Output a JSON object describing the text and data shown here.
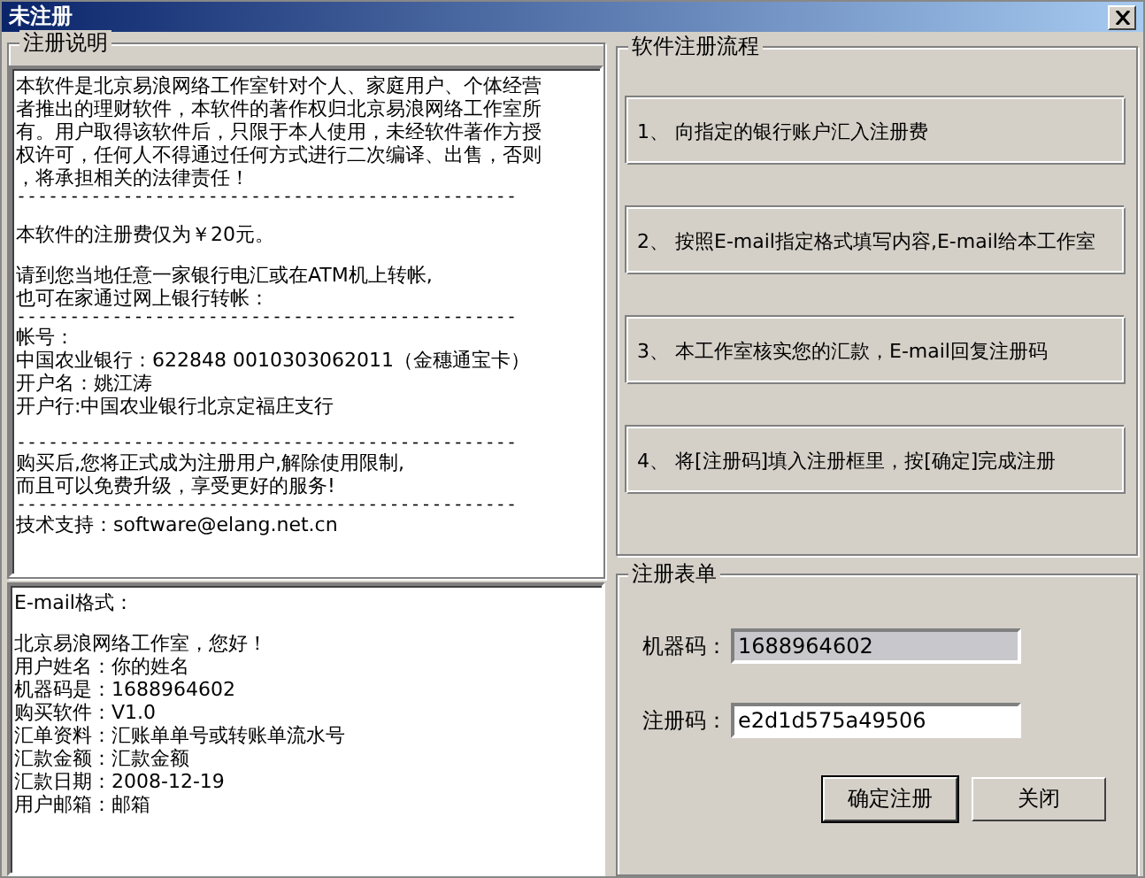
{
  "window": {
    "title": "未注册"
  },
  "notes": {
    "legend": "注册说明",
    "paragraphs": [
      {
        "lines": [
          {
            "kind": "text",
            "text": "本软件是北京易浪网络工作室针对个人、家庭用户、个体经营"
          },
          {
            "kind": "text",
            "text": "者推出的理财软件，本软件的著作权归北京易浪网络工作室所"
          },
          {
            "kind": "text",
            "text": "有。用户取得该软件后，只限于本人使用，未经软件著作方授"
          },
          {
            "kind": "text",
            "text": "权许可，任何人不得通过任何方式进行二次编译、出售，否则"
          },
          {
            "kind": "text",
            "text": "，将承担相关的法律责任！"
          },
          {
            "kind": "rule",
            "text": "-----------------------------------------------"
          }
        ]
      },
      {
        "lines": [
          {
            "kind": "text",
            "text": "本软件的注册费仅为￥20元。"
          }
        ]
      },
      {
        "lines": [
          {
            "kind": "text",
            "text": "请到您当地任意一家银行电汇或在ATM机上转帐,"
          },
          {
            "kind": "text",
            "text": "也可在家通过网上银行转帐："
          },
          {
            "kind": "rule",
            "text": "-----------------------------------------------"
          },
          {
            "kind": "text",
            "text": "帐号："
          },
          {
            "kind": "text",
            "text": "中国农业银行：622848   0010303062011（金穗通宝卡）"
          },
          {
            "kind": "text",
            "text": "开户名：姚江涛"
          },
          {
            "kind": "text",
            "text": "开户行:中国农业银行北京定福庄支行"
          }
        ]
      },
      {
        "lines": [
          {
            "kind": "rule",
            "text": "-----------------------------------------------"
          },
          {
            "kind": "text",
            "text": "购买后,您将正式成为注册用户,解除使用限制,"
          },
          {
            "kind": "text",
            "text": "而且可以免费升级，享受更好的服务!"
          },
          {
            "kind": "rule",
            "text": "-----------------------------------------------"
          },
          {
            "kind": "text",
            "text": "技术支持：software@elang.net.cn"
          }
        ]
      }
    ]
  },
  "email": {
    "paragraphs": [
      {
        "lines": [
          {
            "kind": "text",
            "text": "E-mail格式："
          }
        ]
      },
      {
        "lines": [
          {
            "kind": "text",
            "text": "北京易浪网络工作室，您好！"
          },
          {
            "kind": "text",
            "text": "用户姓名：你的姓名"
          },
          {
            "kind": "text",
            "text": "机器码是：1688964602"
          },
          {
            "kind": "text",
            "text": "购买软件：V1.0"
          },
          {
            "kind": "text",
            "text": "汇单资料：汇账单单号或转账单流水号"
          },
          {
            "kind": "text",
            "text": "汇款金额：汇款金额"
          },
          {
            "kind": "text",
            "text": "汇款日期：2008-12-19"
          },
          {
            "kind": "text",
            "text": "用户邮箱：邮箱"
          }
        ]
      }
    ]
  },
  "steps": {
    "legend": "软件注册流程",
    "items": [
      "1、 向指定的银行账户汇入注册费",
      "2、 按照E-mail指定格式填写内容,E-mail给本工作室",
      "3、 本工作室核实您的汇款，E-mail回复注册码",
      "4、 将[注册码]填入注册框里，按[确定]完成注册"
    ]
  },
  "form": {
    "legend": "注册表单",
    "fields": [
      {
        "label": "机器码：",
        "value": "1688964602",
        "readonly": true
      },
      {
        "label": "注册码：",
        "value": "e2d1d575a49506",
        "readonly": false
      }
    ],
    "buttons": [
      "确定注册",
      "关闭"
    ]
  }
}
